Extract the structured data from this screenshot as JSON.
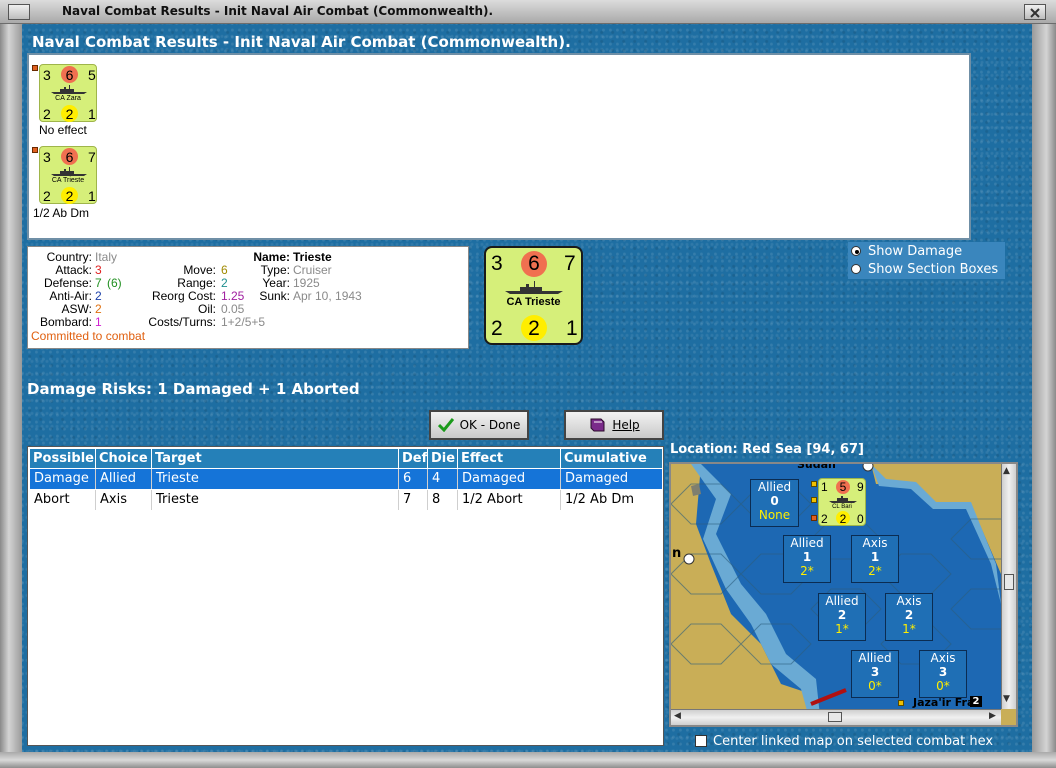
{
  "window": {
    "title": "Naval Combat Results - Init Naval Air Combat (Commonwealth)."
  },
  "heading": "Naval Combat Results - Init Naval Air Combat (Commonwealth).",
  "units": [
    {
      "name": "CA Zara",
      "top_left": "3",
      "top_mid": "6",
      "top_right": "5",
      "bot_left": "2",
      "bot_mid": "2",
      "bot_right": "1",
      "result": "No effect"
    },
    {
      "name": "CA Trieste",
      "top_left": "3",
      "top_mid": "6",
      "top_right": "7",
      "bot_left": "2",
      "bot_mid": "2",
      "bot_right": "1",
      "result": "1/2 Ab Dm"
    }
  ],
  "info": {
    "country_label": "Country:",
    "country": "Italy",
    "attack_label": "Attack:",
    "attack": "3",
    "defense_label": "Defense:",
    "defense": "7",
    "defense_extra": "(6)",
    "antiair_label": "Anti-Air:",
    "antiair": "2",
    "asw_label": "ASW:",
    "asw": "2",
    "bombard_label": "Bombard:",
    "bombard": "1",
    "committed": "Committed to combat",
    "move_label": "Move:",
    "move": "6",
    "range_label": "Range:",
    "range": "2",
    "reorg_label": "Reorg Cost:",
    "reorg": "1.25",
    "oil_label": "Oil:",
    "oil": "0.05",
    "costs_label": "Costs/Turns:",
    "costs": "1+2/5+5",
    "name_label": "Name:",
    "name": "Trieste",
    "type_label": "Type:",
    "type": "Cruiser",
    "year_label": "Year:",
    "year": "1925",
    "sunk_label": "Sunk:",
    "sunk": "Apr 10, 1943"
  },
  "big_counter": {
    "name": "CA Trieste",
    "top_left": "3",
    "top_mid": "6",
    "top_right": "7",
    "bot_left": "2",
    "bot_mid": "2",
    "bot_right": "1"
  },
  "options": {
    "show_damage": "Show Damage",
    "show_section_boxes": "Show Section Boxes",
    "selected": "show_damage"
  },
  "damage_risks": "Damage Risks: 1 Damaged + 1 Aborted",
  "buttons": {
    "ok": "OK - Done",
    "help": "Help"
  },
  "table": {
    "headers": [
      "Possible",
      "Choice",
      "Target",
      "Def",
      "Die",
      "Effect",
      "Cumulative"
    ],
    "rows": [
      {
        "possible": "Damage",
        "choice": "Allied",
        "target": "Trieste",
        "def": "6",
        "die": "4",
        "effect": "Damaged",
        "cumulative": "Damaged",
        "selected": true
      },
      {
        "possible": "Abort",
        "choice": "Axis",
        "target": "Trieste",
        "def": "7",
        "die": "8",
        "effect": "1/2 Abort",
        "cumulative": "1/2 Ab Dm",
        "selected": false
      }
    ]
  },
  "location": "Location: Red Sea [94, 67]",
  "map": {
    "sections": [
      {
        "side": "Allied",
        "num": "0",
        "val": "None"
      },
      {
        "side": "Allied",
        "num": "1",
        "val": "2*"
      },
      {
        "side": "Axis",
        "num": "1",
        "val": "2*"
      },
      {
        "side": "Allied",
        "num": "2",
        "val": "1*"
      },
      {
        "side": "Axis",
        "num": "2",
        "val": "1*"
      },
      {
        "side": "Allied",
        "num": "3",
        "val": "0*"
      },
      {
        "side": "Axis",
        "num": "3",
        "val": "0*"
      }
    ],
    "map_counter": {
      "name": "CL Bari",
      "top_left": "1",
      "top_mid": "5",
      "top_right": "9",
      "bot_left": "2",
      "bot_mid": "2",
      "bot_right": "0"
    },
    "place_label": "Jaza'ir Fras",
    "stack_count": "2",
    "top_label": "Sudan",
    "left_label": "n"
  },
  "center_linked": "Center linked map on selected combat hex",
  "colors": {
    "accent": "#2580b8",
    "selection": "#1574d8",
    "counter": "#d6ef7a",
    "ocean": "#1e6ea2"
  }
}
